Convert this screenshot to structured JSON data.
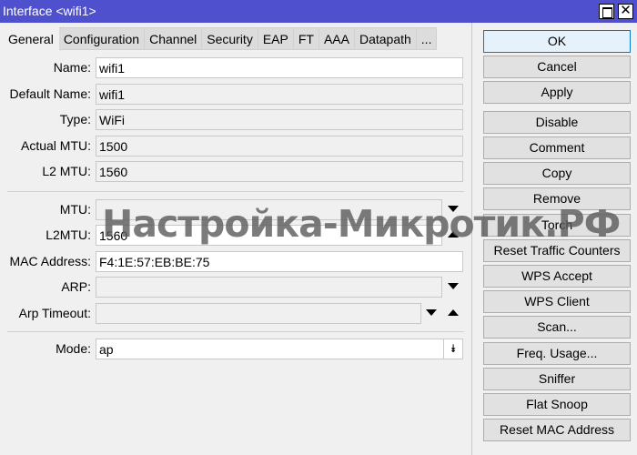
{
  "window": {
    "title": "Interface <wifi1>"
  },
  "tabs": [
    "General",
    "Configuration",
    "Channel",
    "Security",
    "EAP",
    "FT",
    "AAA",
    "Datapath",
    "..."
  ],
  "fields": {
    "name": {
      "label": "Name:",
      "value": "wifi1"
    },
    "default_name": {
      "label": "Default Name:",
      "value": "wifi1"
    },
    "type": {
      "label": "Type:",
      "value": "WiFi"
    },
    "actual_mtu": {
      "label": "Actual MTU:",
      "value": "1500"
    },
    "l2_mtu": {
      "label": "L2 MTU:",
      "value": "1560"
    },
    "mtu": {
      "label": "MTU:",
      "value": ""
    },
    "l2mtu": {
      "label": "L2MTU:",
      "value": "1560"
    },
    "mac": {
      "label": "MAC Address:",
      "value": "F4:1E:57:EB:BE:75"
    },
    "arp": {
      "label": "ARP:",
      "value": ""
    },
    "arp_timeout": {
      "label": "Arp Timeout:",
      "value": ""
    },
    "mode": {
      "label": "Mode:",
      "value": "ap"
    }
  },
  "buttons": [
    "OK",
    "Cancel",
    "Apply",
    "Disable",
    "Comment",
    "Copy",
    "Remove",
    "Torch",
    "Reset Traffic Counters",
    "WPS Accept",
    "WPS Client",
    "Scan...",
    "Freq. Usage...",
    "Sniffer",
    "Flat Snoop",
    "Reset MAC Address"
  ],
  "watermark": "Настройка-Микротик.РФ",
  "colors": {
    "titlebar": "#4f50cd"
  }
}
